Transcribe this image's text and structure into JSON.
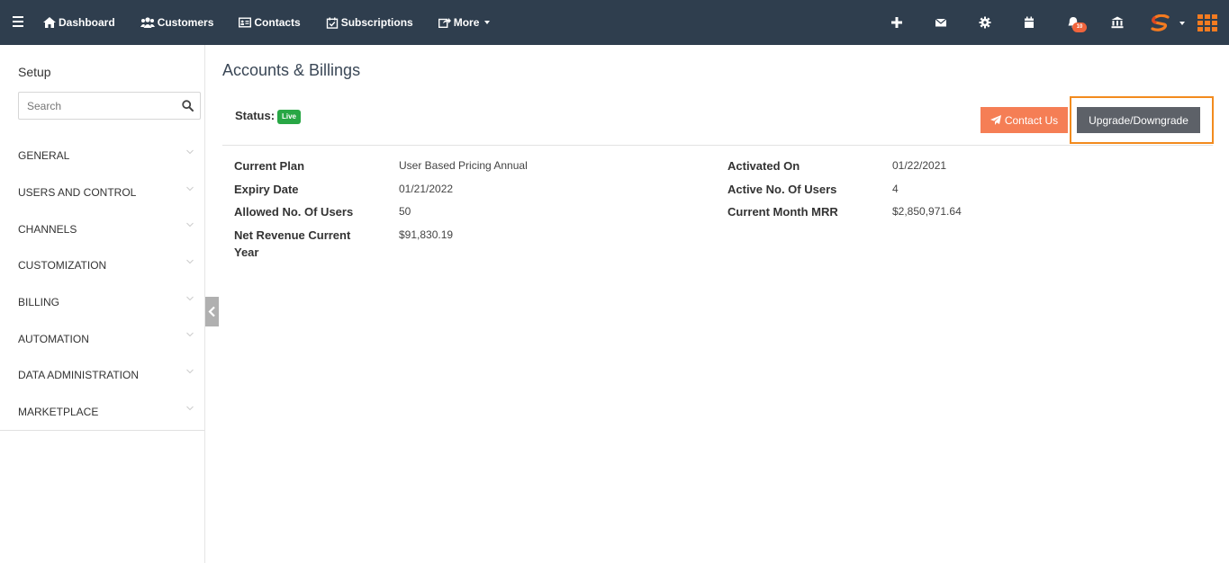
{
  "nav": {
    "items": [
      {
        "label": "Dashboard",
        "icon": "home-icon"
      },
      {
        "label": "Customers",
        "icon": "users-icon"
      },
      {
        "label": "Contacts",
        "icon": "id-card-icon"
      },
      {
        "label": "Subscriptions",
        "icon": "calendar-check-icon"
      },
      {
        "label": "More",
        "icon": "share-icon"
      }
    ],
    "notification_count": "10",
    "icons": [
      "plus-icon",
      "envelope-icon",
      "gear-icon",
      "calendar-icon",
      "bell-icon",
      "bank-icon",
      "brand-logo-icon",
      "apps-grid-icon"
    ],
    "bg_color": "#2f3e4e",
    "accent": "#f47b20"
  },
  "sidebar": {
    "title": "Setup",
    "search_placeholder": "Search",
    "items": [
      {
        "label": "GENERAL"
      },
      {
        "label": "USERS AND CONTROL"
      },
      {
        "label": "CHANNELS"
      },
      {
        "label": "CUSTOMIZATION"
      },
      {
        "label": "BILLING"
      },
      {
        "label": "AUTOMATION"
      },
      {
        "label": "DATA ADMINISTRATION"
      },
      {
        "label": "MARKETPLACE"
      }
    ]
  },
  "main": {
    "title": "Accounts & Billings",
    "status_label": "Status:",
    "status_value": "Live",
    "contact_button": "Contact Us",
    "upgrade_button": "Upgrade/Downgrade",
    "fields_left": [
      {
        "label": "Current Plan",
        "value": "User Based Pricing Annual"
      },
      {
        "label": "Expiry Date",
        "value": "01/21/2022"
      },
      {
        "label": "Allowed No. Of Users",
        "value": "50"
      },
      {
        "label": "Net Revenue Current Year",
        "value": "$91,830.19"
      }
    ],
    "fields_right": [
      {
        "label": "Activated On",
        "value": "01/22/2021"
      },
      {
        "label": "Active No. Of Users",
        "value": "4"
      },
      {
        "label": "Current Month MRR",
        "value": "$2,850,971.64"
      }
    ],
    "colors": {
      "contact_button": "#f57e55",
      "upgrade_button": "#5d6168",
      "live_badge": "#28a745",
      "highlight": "#f28b1e"
    }
  }
}
